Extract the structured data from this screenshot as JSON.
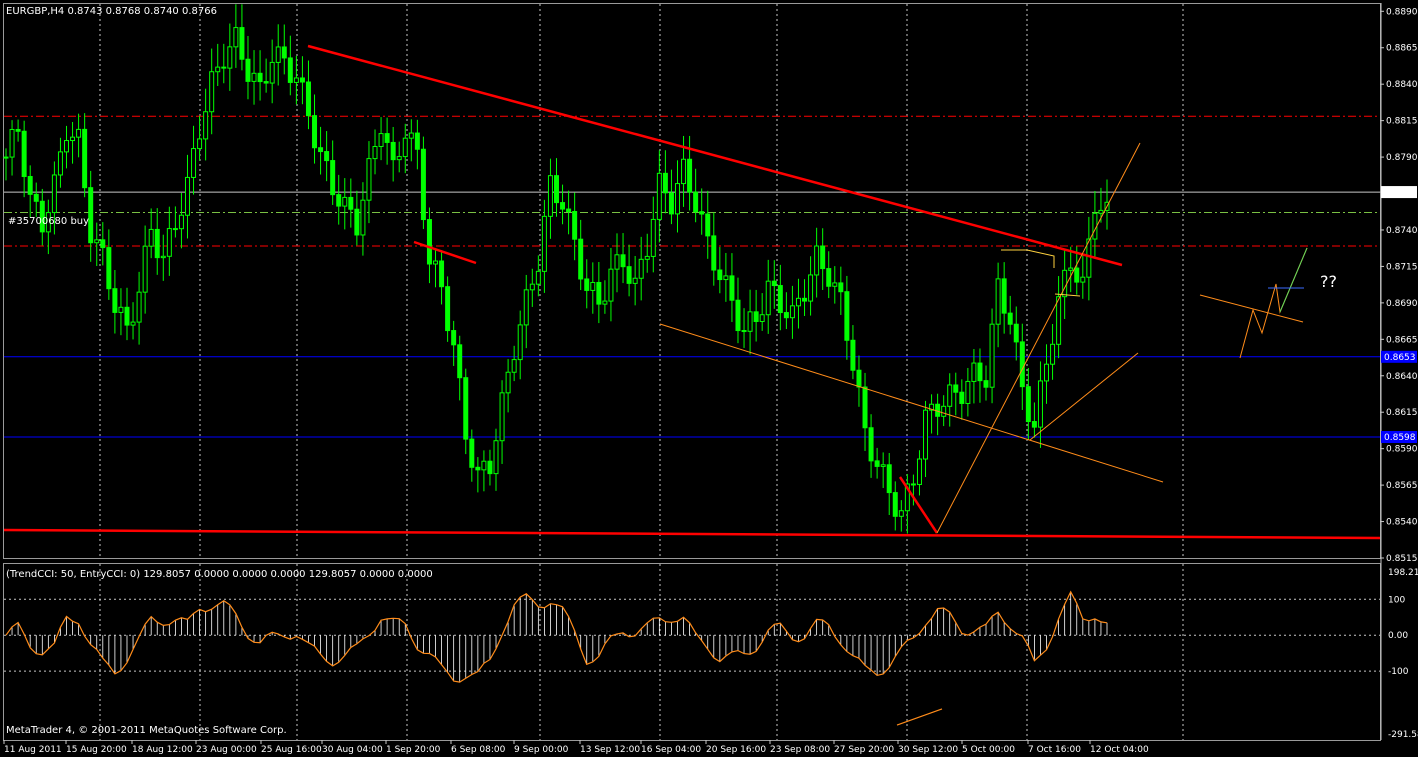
{
  "header": {
    "symbol_info": "EURGBP,H4  0.8743 0.8768 0.8740 0.8766"
  },
  "order_label": "#35700680 buy",
  "indicator_header": "(TrendCCI: 50, EntryCCI: 0)  129.8057 0.0000 0.0000 0.0000 129.8057 0.0000 0.0000",
  "copyright": "MetaTrader 4, © 2001-2011 MetaQuotes Software Corp.",
  "question_marks": "??",
  "price_scale": [
    "0.8890",
    "0.8865",
    "0.8840",
    "0.8815",
    "0.8790",
    "0.8766",
    "0.8740",
    "0.8715",
    "0.8690",
    "0.8665",
    "0.8640",
    "0.8615",
    "0.8590",
    "0.8565",
    "0.8540",
    "0.8515"
  ],
  "current_price_tag": "0.8766",
  "blue_line_tags": [
    "0.8653",
    "0.8598"
  ],
  "cci_scale": [
    "198.215",
    "100",
    "0.00",
    "-100",
    "-291.589"
  ],
  "time_axis": [
    "11 Aug 2011",
    "15 Aug 20:00",
    "18 Aug 12:00",
    "23 Aug 00:00",
    "25 Aug 16:00",
    "30 Aug 04:00",
    "1 Sep 20:00",
    "6 Sep 08:00",
    "9 Sep 00:00",
    "13 Sep 12:00",
    "16 Sep 04:00",
    "20 Sep 16:00",
    "23 Sep 08:00",
    "27 Sep 20:00",
    "30 Sep 12:00",
    "5 Oct 00:00",
    "7 Oct 16:00",
    "12 Oct 04:00"
  ],
  "colors": {
    "background": "#000000",
    "candles": "#00ff00",
    "grid": "#c8c8c8",
    "trend_line": "#ff0000",
    "channel": "#ff8c1a",
    "support": "#0000ff",
    "cci": "#ff8c1a",
    "cci_hist": "#ffffff"
  },
  "chart_data": {
    "type": "candlestick",
    "symbol": "EURGBP",
    "timeframe": "H4",
    "ylim": [
      0.8515,
      0.8895
    ],
    "x_labels": [
      "11 Aug 2011",
      "15 Aug 20:00",
      "18 Aug 12:00",
      "23 Aug 00:00",
      "25 Aug 16:00",
      "30 Aug 04:00",
      "1 Sep 20:00",
      "6 Sep 08:00",
      "9 Sep 00:00",
      "13 Sep 12:00",
      "16 Sep 04:00",
      "20 Sep 16:00",
      "23 Sep 08:00",
      "27 Sep 20:00",
      "30 Sep 12:00",
      "5 Oct 00:00",
      "7 Oct 16:00",
      "12 Oct 04:00"
    ],
    "close_path": [
      [
        0,
        0.879
      ],
      [
        2,
        0.881
      ],
      [
        4,
        0.876
      ],
      [
        6,
        0.8745
      ],
      [
        8,
        0.877
      ],
      [
        10,
        0.881
      ],
      [
        12,
        0.88
      ],
      [
        14,
        0.874
      ],
      [
        16,
        0.872
      ],
      [
        18,
        0.869
      ],
      [
        20,
        0.867
      ],
      [
        22,
        0.87
      ],
      [
        24,
        0.874
      ],
      [
        26,
        0.872
      ],
      [
        28,
        0.8745
      ],
      [
        30,
        0.877
      ],
      [
        32,
        0.881
      ],
      [
        34,
        0.884
      ],
      [
        36,
        0.886
      ],
      [
        38,
        0.887
      ],
      [
        40,
        0.885
      ],
      [
        42,
        0.8835
      ],
      [
        44,
        0.886
      ],
      [
        46,
        0.8855
      ],
      [
        48,
        0.8845
      ],
      [
        50,
        0.882
      ],
      [
        52,
        0.879
      ],
      [
        54,
        0.877
      ],
      [
        56,
        0.8755
      ],
      [
        58,
        0.8745
      ],
      [
        60,
        0.878
      ],
      [
        62,
        0.8815
      ],
      [
        64,
        0.878
      ],
      [
        66,
        0.881
      ],
      [
        68,
        0.879
      ],
      [
        70,
        0.872
      ],
      [
        72,
        0.87
      ],
      [
        74,
        0.866
      ],
      [
        76,
        0.86
      ],
      [
        78,
        0.857
      ],
      [
        80,
        0.858
      ],
      [
        82,
        0.862
      ],
      [
        84,
        0.866
      ],
      [
        86,
        0.869
      ],
      [
        88,
        0.872
      ],
      [
        90,
        0.877
      ],
      [
        92,
        0.876
      ],
      [
        94,
        0.873
      ],
      [
        96,
        0.87
      ],
      [
        98,
        0.869
      ],
      [
        100,
        0.871
      ],
      [
        102,
        0.872
      ],
      [
        104,
        0.87
      ],
      [
        106,
        0.873
      ],
      [
        108,
        0.877
      ],
      [
        110,
        0.876
      ],
      [
        112,
        0.878
      ],
      [
        114,
        0.876
      ],
      [
        116,
        0.873
      ],
      [
        118,
        0.871
      ],
      [
        120,
        0.869
      ],
      [
        122,
        0.867
      ],
      [
        124,
        0.868
      ],
      [
        126,
        0.87
      ],
      [
        128,
        0.869
      ],
      [
        130,
        0.868
      ],
      [
        132,
        0.87
      ],
      [
        134,
        0.872
      ],
      [
        136,
        0.871
      ],
      [
        138,
        0.869
      ],
      [
        140,
        0.865
      ],
      [
        142,
        0.86
      ],
      [
        144,
        0.858
      ],
      [
        146,
        0.856
      ],
      [
        148,
        0.8545
      ],
      [
        150,
        0.857
      ],
      [
        152,
        0.861
      ],
      [
        154,
        0.862
      ],
      [
        156,
        0.8625
      ],
      [
        158,
        0.863
      ],
      [
        160,
        0.864
      ],
      [
        162,
        0.864
      ],
      [
        164,
        0.87
      ],
      [
        166,
        0.868
      ],
      [
        168,
        0.863
      ],
      [
        170,
        0.8605
      ],
      [
        172,
        0.865
      ],
      [
        174,
        0.869
      ],
      [
        176,
        0.872
      ],
      [
        178,
        0.87
      ],
      [
        180,
        0.876
      ],
      [
        182,
        0.875
      ]
    ],
    "indicator": {
      "name": "TrendCCI",
      "params": "TrendCCI: 50, EntryCCI: 0",
      "value": 129.8057,
      "ylim": [
        -291.589,
        198.215
      ],
      "levels": [
        100,
        0,
        -100
      ]
    }
  }
}
